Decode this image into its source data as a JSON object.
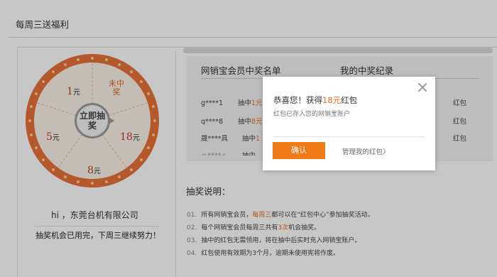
{
  "page": {
    "title": "每周三送福利"
  },
  "wheel": {
    "prizes": [
      {
        "value": "1",
        "unit": "元"
      },
      {
        "value": "5",
        "unit": "元"
      },
      {
        "value": "18",
        "unit": "元"
      },
      {
        "value": "8",
        "unit": "元"
      }
    ],
    "miss_label": "未中奖",
    "start_label": "立即抽奖"
  },
  "user": {
    "greeting": "hi ，东莞台机有限公司",
    "chance_note": "抽奖机会已用完，下周三继续努力！"
  },
  "winners": {
    "title": "网销宝会员中奖名单",
    "rows": [
      {
        "name": "g****1",
        "prefix": "抽中",
        "amount": "1元"
      },
      {
        "name": "q****8",
        "prefix": "抽中",
        "amount": "8元"
      },
      {
        "name": "晟****具",
        "prefix": "抽中",
        "amount": "1"
      }
    ],
    "partial_top": "",
    "partial_bottom": "抽中"
  },
  "my_records": {
    "title": "我的中奖纪录",
    "rows": [
      "红包",
      "红包",
      "红包"
    ]
  },
  "rules": {
    "title": "抽奖说明：",
    "items": [
      {
        "num": "01.",
        "before": "所有网销宝会员，",
        "highlight": "每周三",
        "after": "都可以在“红包中心”参加抽奖活动。"
      },
      {
        "num": "02.",
        "before": "每个网销宝会员每周三共有",
        "highlight": "3次",
        "after": "机会抽奖。"
      },
      {
        "num": "03.",
        "before": "抽中的红包无需领用，将在抽中后实时充入网销宝账户。",
        "highlight": "",
        "after": ""
      },
      {
        "num": "04.",
        "before": "红包使用有效期为3个月，逾期未使用宪将作废。",
        "highlight": "",
        "after": ""
      }
    ]
  },
  "modal": {
    "title_before": "恭喜您！获得",
    "amount": "18元",
    "title_after": "红包",
    "subtitle": "红包已存入您的网销宝账户",
    "confirm_label": "确认",
    "manage_label": "管理我的红包〉"
  },
  "colors": {
    "accent": "#f07a15",
    "wheel_rim": "#e8723a",
    "prize_red": "#c23a1e"
  }
}
